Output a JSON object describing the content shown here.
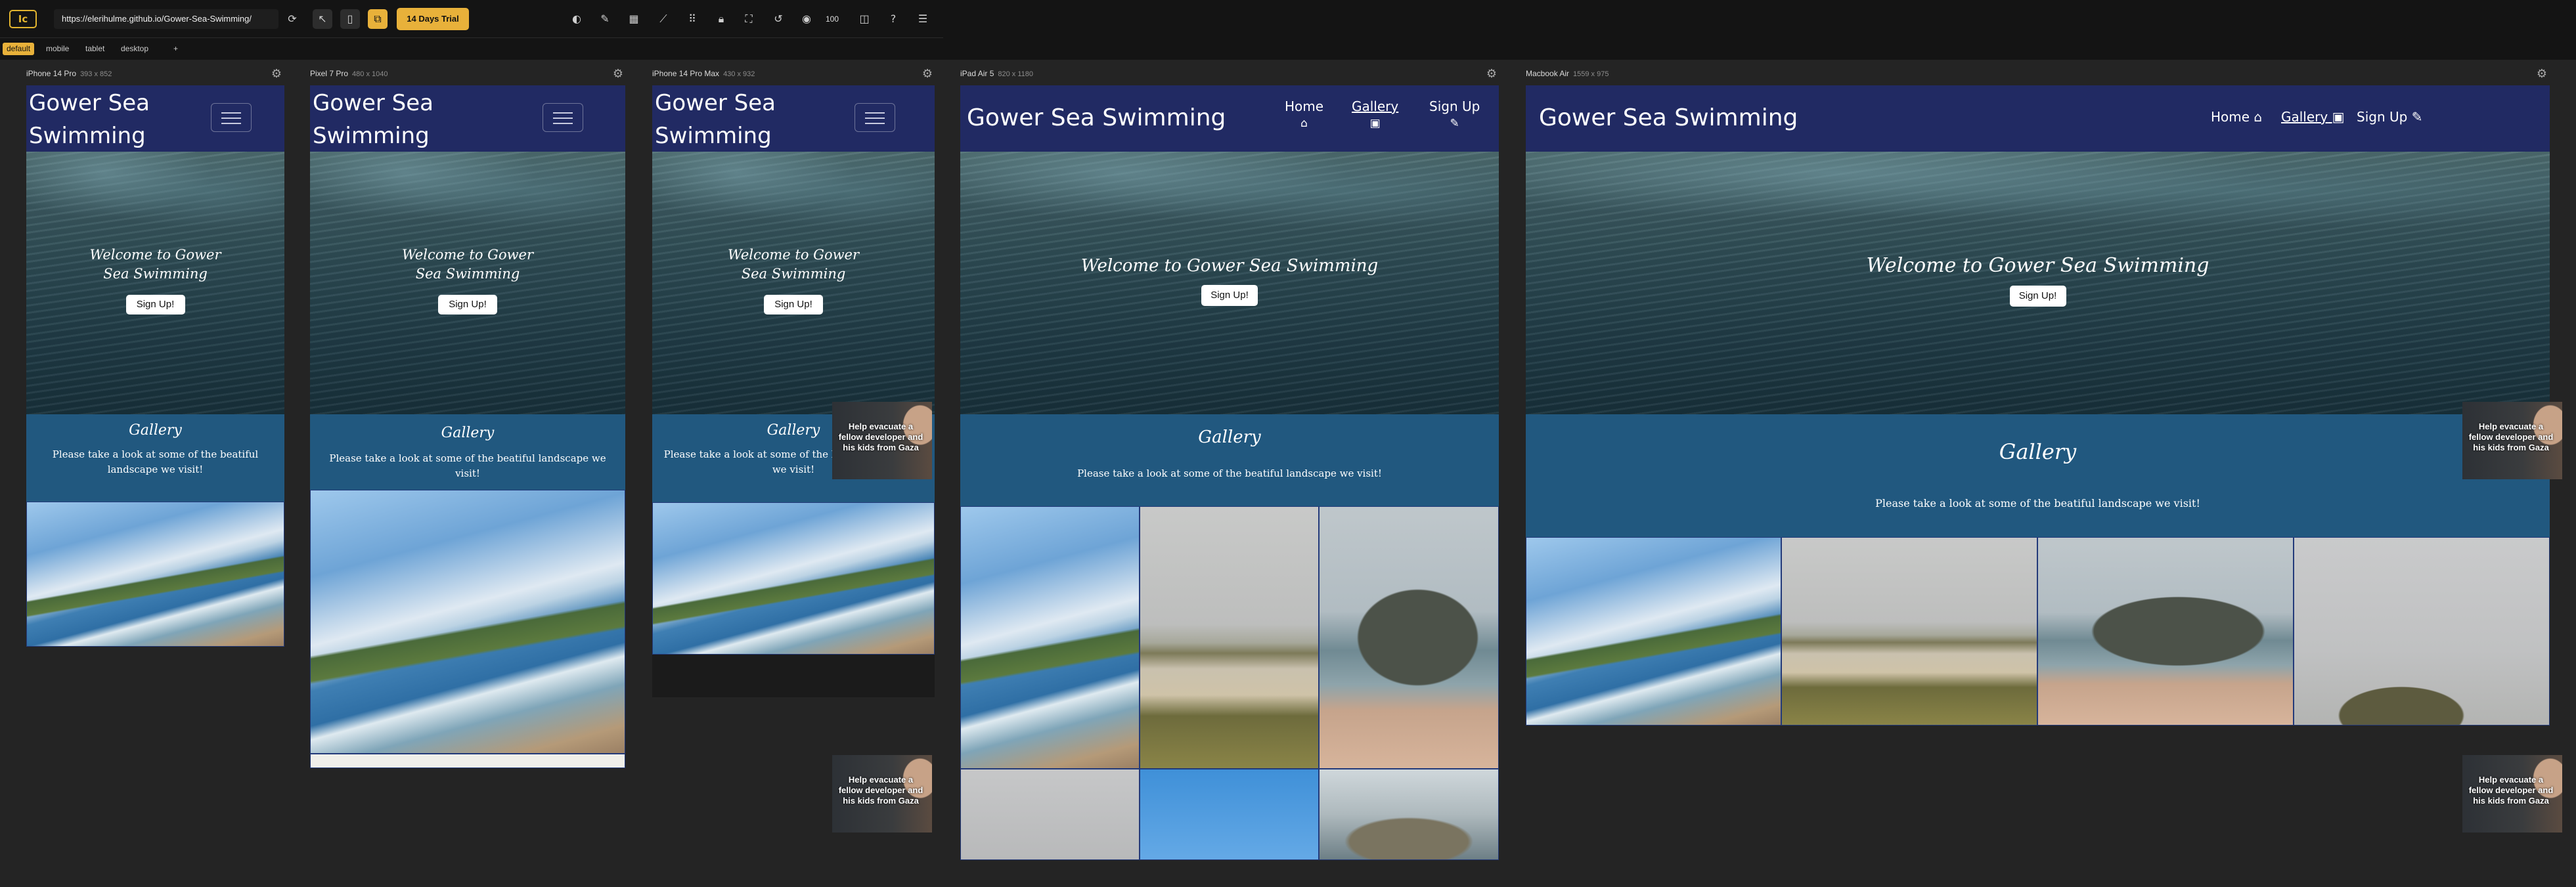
{
  "toolbar": {
    "url": "https://elerihulme.github.io/Gower-Sea-Swimming/",
    "trial_label": "14 Days Trial",
    "zoom": "100",
    "logo": "Ic"
  },
  "tabs": [
    {
      "label": "default"
    },
    {
      "label": "mobile"
    },
    {
      "label": "tablet"
    },
    {
      "label": "desktop"
    },
    {
      "label": "+"
    }
  ],
  "site": {
    "brand": "Gower Sea Swimming",
    "brand_line1": "Gower Sea",
    "brand_line2": "Swimming",
    "nav": {
      "home": "Home",
      "gallery": "Gallery",
      "signup": "Sign Up"
    },
    "hero_title": "Welcome to Gower Sea Swimming",
    "hero_title_line1": "Welcome to Gower",
    "hero_title_line2": "Sea Swimming",
    "hero_button": "Sign Up!",
    "gallery_title": "Gallery",
    "gallery_text": "Please take a look at some of the beatiful landscape we visit!"
  },
  "badge_text": "Help evacuate a fellow developer and his kids from Gaza",
  "devices": [
    {
      "name": "iPhone 14 Pro",
      "size": "393 x 852"
    },
    {
      "name": "Pixel 7 Pro",
      "size": "480 x 1040"
    },
    {
      "name": "iPhone 14 Pro Max",
      "size": "430 x 932"
    },
    {
      "name": "iPad Air 5",
      "size": "820 x 1180"
    },
    {
      "name": "Macbook Air",
      "size": "1559 x 975"
    }
  ],
  "colors": {
    "accent": "#e8b13a",
    "navbar": "#212a63",
    "gallery_bg": "#21587f"
  }
}
